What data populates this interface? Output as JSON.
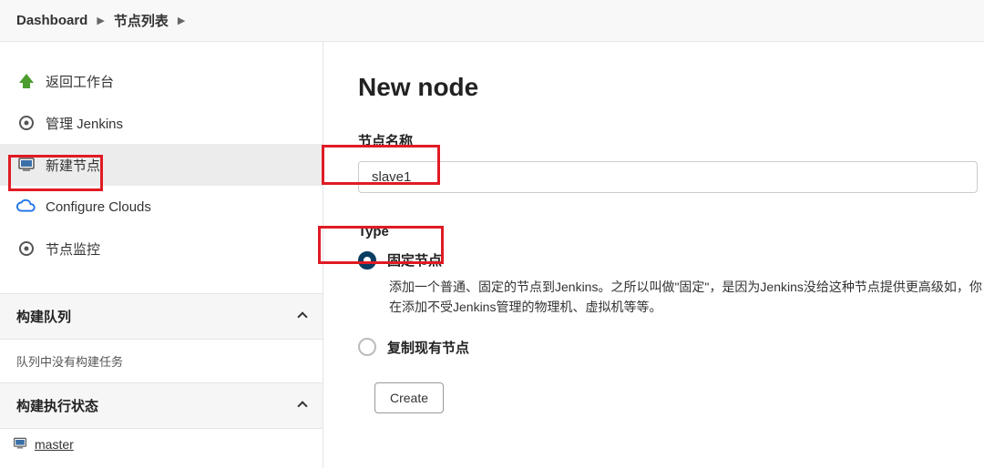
{
  "breadcrumb": {
    "items": [
      "Dashboard",
      "节点列表"
    ]
  },
  "sidebar": {
    "items": [
      {
        "id": "back",
        "label": "返回工作台",
        "icon": "arrow-up"
      },
      {
        "id": "manage",
        "label": "管理 Jenkins",
        "icon": "gear"
      },
      {
        "id": "new-node",
        "label": "新建节点",
        "icon": "monitor",
        "active": true
      },
      {
        "id": "clouds",
        "label": "Configure Clouds",
        "icon": "cloud"
      },
      {
        "id": "monitor",
        "label": "节点监控",
        "icon": "gear2"
      }
    ],
    "queue_title": "构建队列",
    "queue_empty": "队列中没有构建任务",
    "exec_title": "构建执行状态",
    "exec_item": "master"
  },
  "main": {
    "title": "New node",
    "name_label": "节点名称",
    "name_value": "slave1",
    "type_label": "Type",
    "type_fixed": "固定节点",
    "type_fixed_desc": "添加一个普通、固定的节点到Jenkins。之所以叫做\"固定\"，是因为Jenkins没给这种节点提供更高级如，你在添加不受Jenkins管理的物理机、虚拟机等等。",
    "type_copy": "复制现有节点",
    "create_button": "Create"
  }
}
